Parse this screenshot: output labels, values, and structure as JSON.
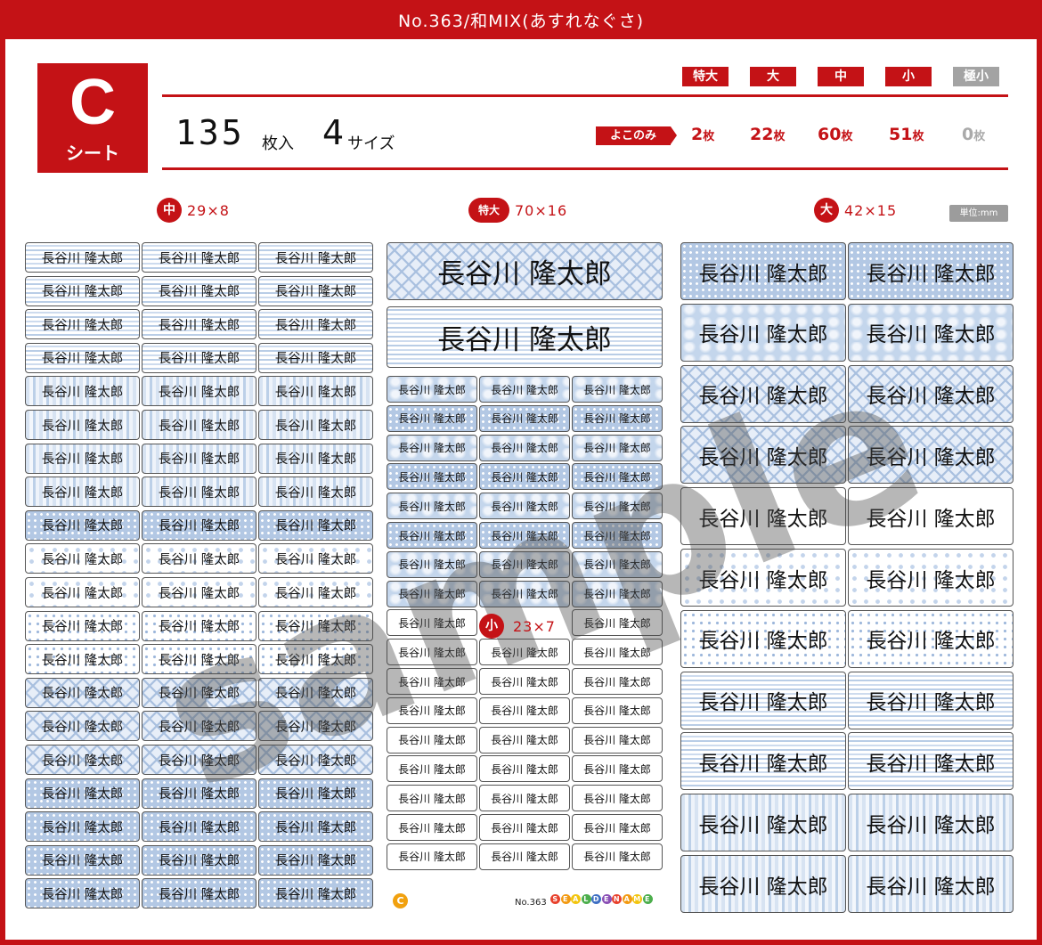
{
  "header": {
    "title": "No.363/和MIX(あすれなぐさ)"
  },
  "badge": {
    "letter": "C",
    "label": "シート"
  },
  "size_tags": [
    {
      "label": "特大",
      "enabled": true
    },
    {
      "label": "大",
      "enabled": true
    },
    {
      "label": "中",
      "enabled": true
    },
    {
      "label": "小",
      "enabled": true
    },
    {
      "label": "極小",
      "enabled": false
    }
  ],
  "summary": {
    "count": "135",
    "count_unit": "枚入",
    "sizes": "4",
    "sizes_unit": "サイズ"
  },
  "horizontal_only": "よこのみ",
  "quantities": [
    {
      "value": "2",
      "unit": "枚",
      "enabled": true
    },
    {
      "value": "22",
      "unit": "枚",
      "enabled": true
    },
    {
      "value": "60",
      "unit": "枚",
      "enabled": true
    },
    {
      "value": "51",
      "unit": "枚",
      "enabled": true
    },
    {
      "value": "0",
      "unit": "枚",
      "enabled": false
    }
  ],
  "sections": {
    "medium": {
      "tag": "中",
      "dims": "29×8"
    },
    "xlarge": {
      "tag": "特大",
      "dims": "70×16"
    },
    "large": {
      "tag": "大",
      "dims": "42×15"
    },
    "small": {
      "tag": "小",
      "dims": "23×7"
    }
  },
  "unit_note": "単位:mm",
  "label_name": "長谷川 隆太郎",
  "watermark": "sample",
  "footer": {
    "sheet_mark": "C",
    "product_no": "No.363",
    "brand": "SEAL DE NAME"
  },
  "colors": {
    "brand_red": "#c41216",
    "inactive_gray": "#a3a3a3",
    "pattern_blue": "#9db7db"
  }
}
